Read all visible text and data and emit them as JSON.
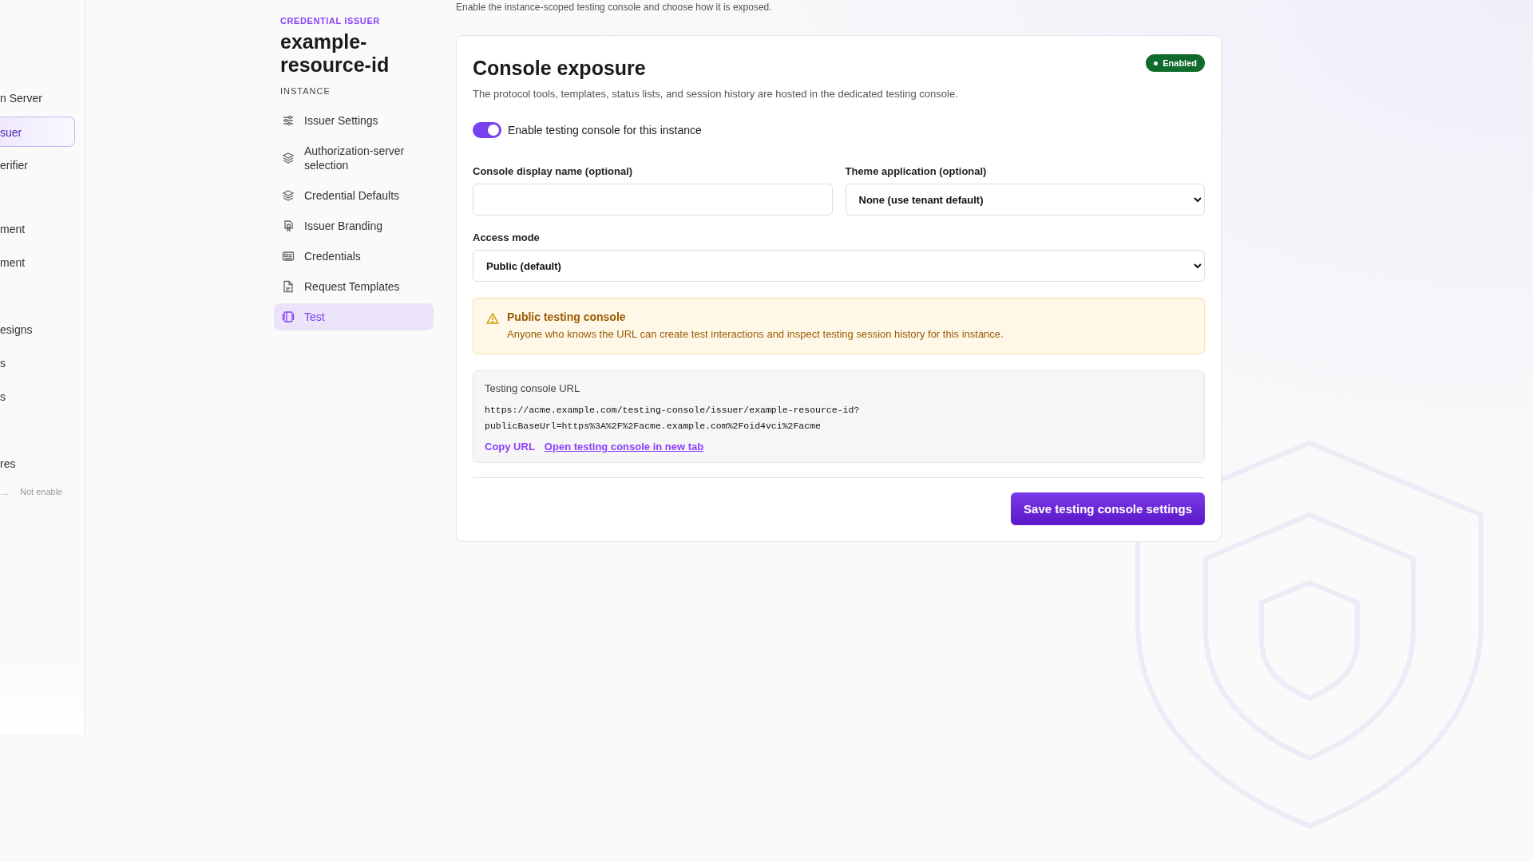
{
  "sidebar": {
    "items": [
      {
        "label": "n Server",
        "selected": false
      },
      {
        "label": "suer",
        "selected": true
      },
      {
        "label": "erifier",
        "selected": false
      },
      {
        "label": "ment",
        "selected": false
      },
      {
        "label": "ment",
        "selected": false
      },
      {
        "label": "esigns",
        "selected": false
      },
      {
        "label": "s",
        "selected": false
      },
      {
        "label": "s",
        "selected": false
      },
      {
        "label": "res",
        "selected": false
      }
    ],
    "footer": {
      "label": "…",
      "status": "Not enable"
    }
  },
  "nav": {
    "eyebrow": "CREDENTIAL ISSUER",
    "title": "example-resource-id",
    "section": "INSTANCE",
    "items": [
      {
        "label": "Issuer Settings",
        "kind": "sliders",
        "selected": false
      },
      {
        "label": "Authorization-server selection",
        "kind": "layers",
        "selected": false
      },
      {
        "label": "Credential Defaults",
        "kind": "layers",
        "selected": false
      },
      {
        "label": "Issuer Branding",
        "kind": "badge",
        "selected": false
      },
      {
        "label": "Credentials",
        "kind": "idcard",
        "selected": false
      },
      {
        "label": "Request Templates",
        "kind": "document",
        "selected": false
      },
      {
        "label": "Test",
        "kind": "frame",
        "selected": true
      }
    ]
  },
  "page_subtitle": "Enable the instance-scoped testing console and choose how it is exposed.",
  "card": {
    "title": "Console exposure",
    "description": "The protocol tools, templates, status lists, and session history are hosted in the dedicated testing console.",
    "status_badge": {
      "label": "Enabled",
      "on": true
    },
    "toggle": {
      "label": "Enable testing console for this instance",
      "on": true
    },
    "fields": [
      {
        "kind": "text",
        "label": "Console display name (optional)"
      },
      {
        "kind": "select",
        "label": "Theme application (optional)",
        "value": "None (use tenant default)"
      }
    ],
    "access_mode": {
      "label": "Access mode",
      "value": "Public (default)"
    },
    "alert": {
      "title": "Public testing console",
      "message": "Anyone who knows the URL can create test interactions and inspect testing session history for this instance."
    },
    "url_box": {
      "label": "Testing console URL",
      "lines": [
        "https://acme.example.com/testing-console/issuer/example-resource-id?",
        "publicBaseUrl=https%3A%2F%2Facme.example.com%2Foid4vci%2Facme"
      ],
      "copy_link": "Copy URL",
      "open_link": "Open testing console in new tab"
    },
    "save_button": "Save testing console settings"
  }
}
